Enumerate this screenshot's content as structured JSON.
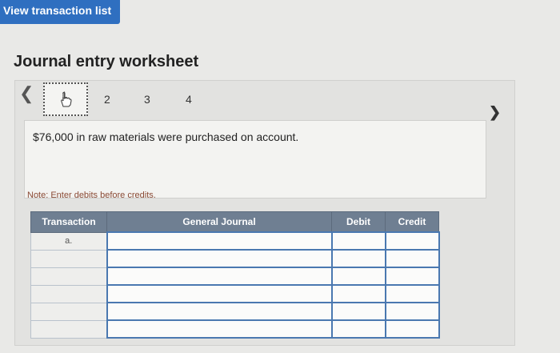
{
  "header": {
    "view_list_label": "View transaction list"
  },
  "worksheet": {
    "title": "Journal entry worksheet",
    "steps": [
      "1",
      "2",
      "3",
      "4"
    ],
    "description": "$76,000 in raw materials were purchased on account.",
    "note": "Note: Enter debits before credits."
  },
  "table": {
    "headers": [
      "Transaction",
      "General Journal",
      "Debit",
      "Credit"
    ],
    "rows": [
      {
        "transaction": "a."
      },
      {
        "transaction": ""
      },
      {
        "transaction": ""
      },
      {
        "transaction": ""
      },
      {
        "transaction": ""
      },
      {
        "transaction": ""
      }
    ]
  },
  "icons": {
    "prev": "chevron-left-icon",
    "next": "chevron-right-icon",
    "cursor": "hand-pointer-icon"
  },
  "colors": {
    "accent": "#2f6fc0",
    "table_header": "#6f7f92",
    "entry_border": "#4a78b0"
  }
}
